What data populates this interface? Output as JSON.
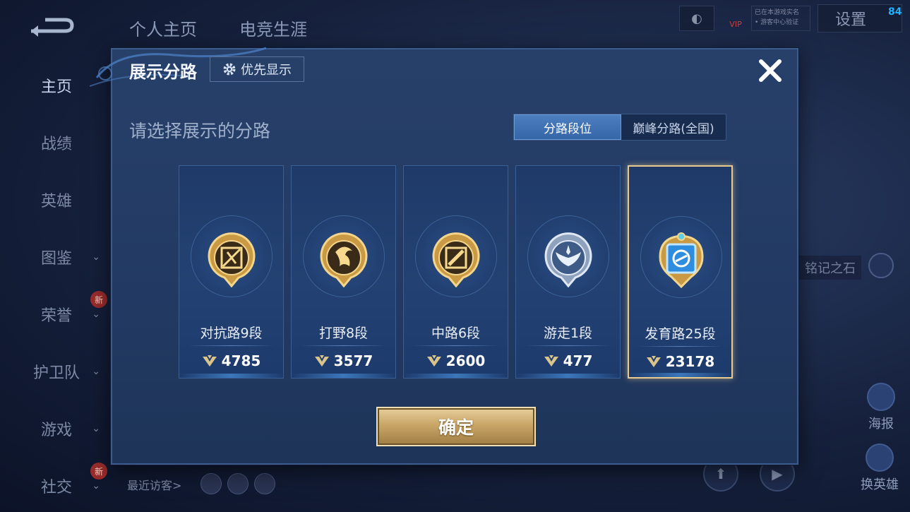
{
  "background": {
    "top_tabs": [
      "个人主页",
      "电竞生涯"
    ],
    "sidebar": [
      {
        "label": "主页",
        "active": true,
        "chevron": false,
        "new": false
      },
      {
        "label": "战绩",
        "active": false,
        "chevron": false,
        "new": false
      },
      {
        "label": "英雄",
        "active": false,
        "chevron": false,
        "new": false
      },
      {
        "label": "图鉴",
        "active": false,
        "chevron": true,
        "new": false
      },
      {
        "label": "荣誉",
        "active": false,
        "chevron": true,
        "new": true
      },
      {
        "label": "护卫队",
        "active": false,
        "chevron": true,
        "new": false
      },
      {
        "label": "游戏",
        "active": false,
        "chevron": true,
        "new": false
      },
      {
        "label": "社交",
        "active": false,
        "chevron": true,
        "new": true
      }
    ],
    "new_tag": "新",
    "vip_label": "VIP",
    "auth_line1": "已在本游戏实名",
    "auth_line2": "• 游客中心验证",
    "settings_label": "设置",
    "fps": "84",
    "stone_label": "铭记之石",
    "poster_label": "海报",
    "swap_hero_label": "换英雄",
    "recent_visitors_label": "最近访客>"
  },
  "dialog": {
    "title": "展示分路",
    "priority_button": "优先显示",
    "subtitle": "请选择展示的分路",
    "segment": {
      "options": [
        "分路段位",
        "巅峰分路(全国)"
      ],
      "selected": "分路段位"
    },
    "cards": [
      {
        "lane": "对抗路9段",
        "points": "4785",
        "badge_icon": "clash-lane-emblem-gold",
        "selected": false
      },
      {
        "lane": "打野8段",
        "points": "3577",
        "badge_icon": "jungle-dragon-emblem-gold",
        "selected": false
      },
      {
        "lane": "中路6段",
        "points": "2600",
        "badge_icon": "mid-lane-emblem-gold",
        "selected": false
      },
      {
        "lane": "游走1段",
        "points": "477",
        "badge_icon": "roam-wings-emblem-silver",
        "selected": false
      },
      {
        "lane": "发育路25段",
        "points": "23178",
        "badge_icon": "farm-lane-emblem-blue-gold",
        "selected": true
      }
    ],
    "confirm_button": "确定",
    "colors": {
      "accent_gold": "#e8c98e",
      "segment_active": "#3f74b7",
      "dialog_bg": "#243d66"
    }
  }
}
